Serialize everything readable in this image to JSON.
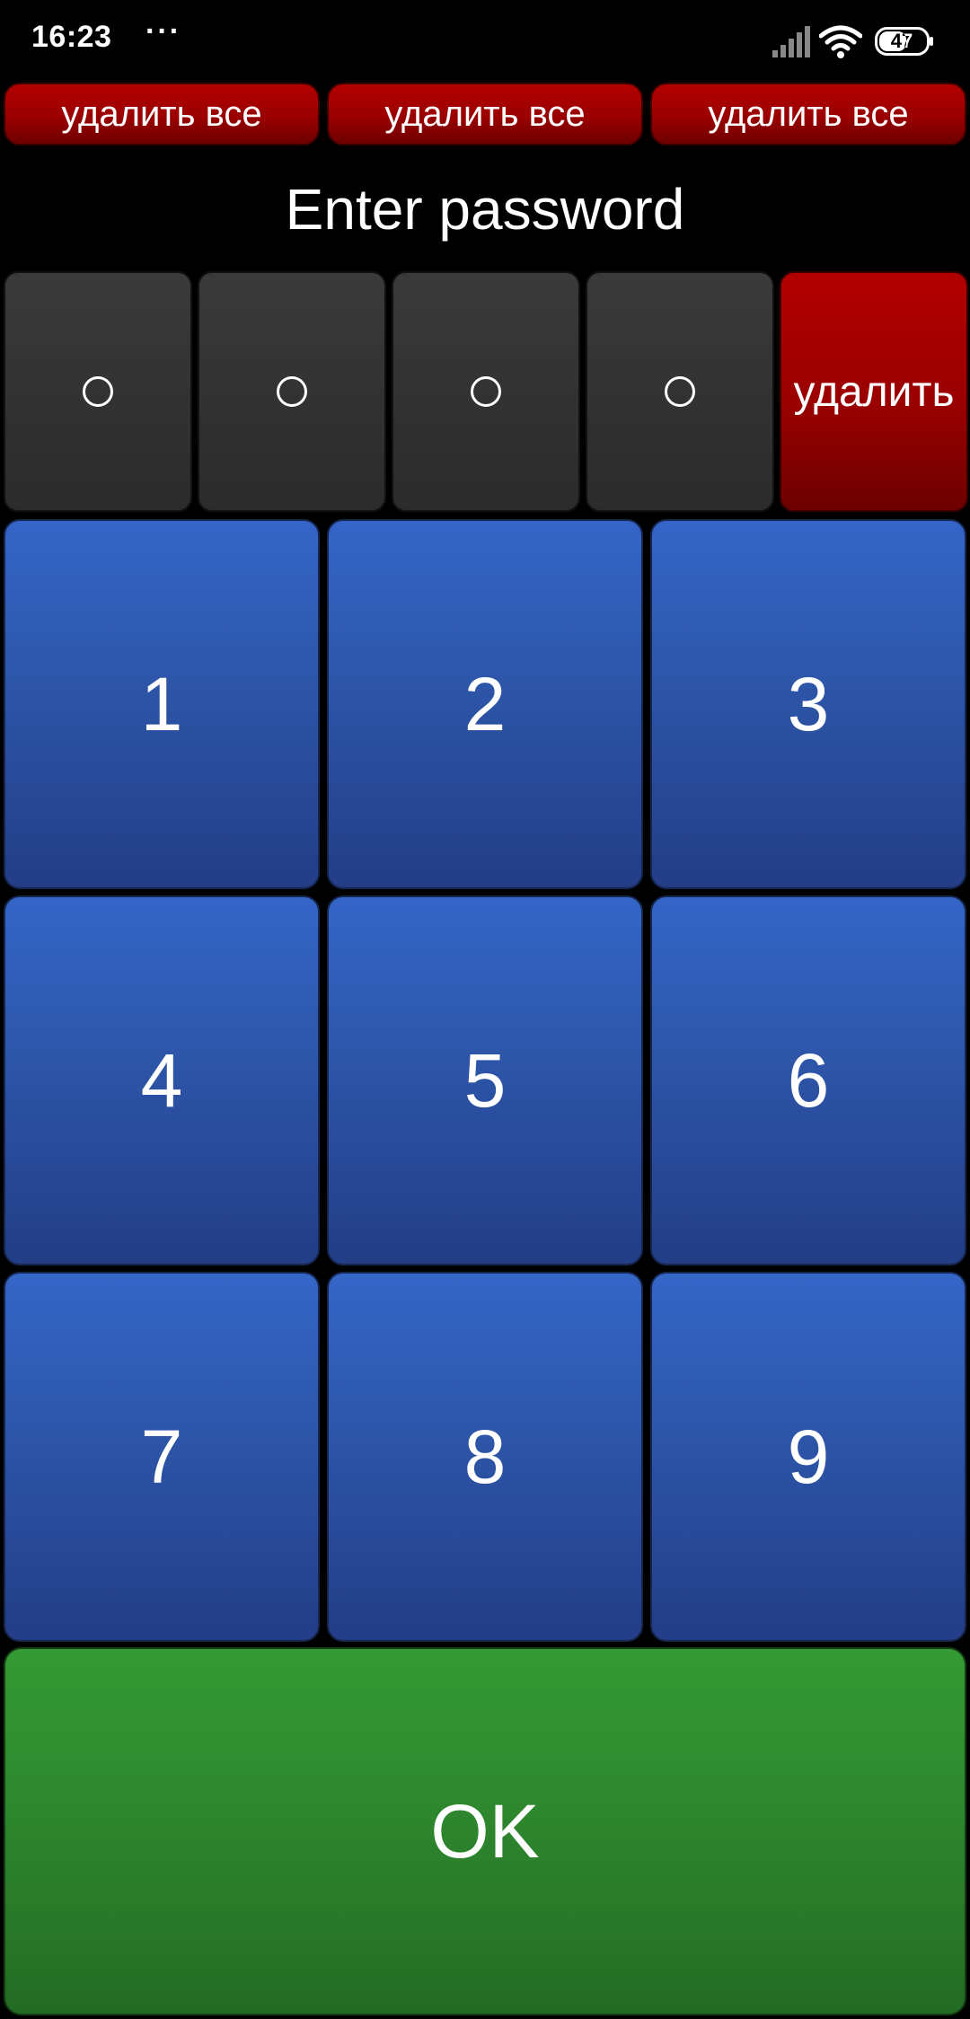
{
  "status_bar": {
    "time": "16:23",
    "dots": "···",
    "battery": "47",
    "icons": [
      "signal-icon",
      "wifi-icon",
      "battery-icon"
    ]
  },
  "top_buttons": [
    {
      "label": "удалить все"
    },
    {
      "label": "удалить все"
    },
    {
      "label": "удалить все"
    }
  ],
  "title": "Enter password",
  "pin": {
    "filled": 0,
    "length": 4
  },
  "delete_label": "удалить",
  "keypad": [
    "1",
    "2",
    "3",
    "4",
    "5",
    "6",
    "7",
    "8",
    "9"
  ],
  "ok_label": "OK",
  "colors": {
    "background": "#000000",
    "red": "#9a0000",
    "gray": "#2e2e2e",
    "blue": "#2d55a8",
    "green": "#2c822c",
    "text": "#ffffff"
  }
}
